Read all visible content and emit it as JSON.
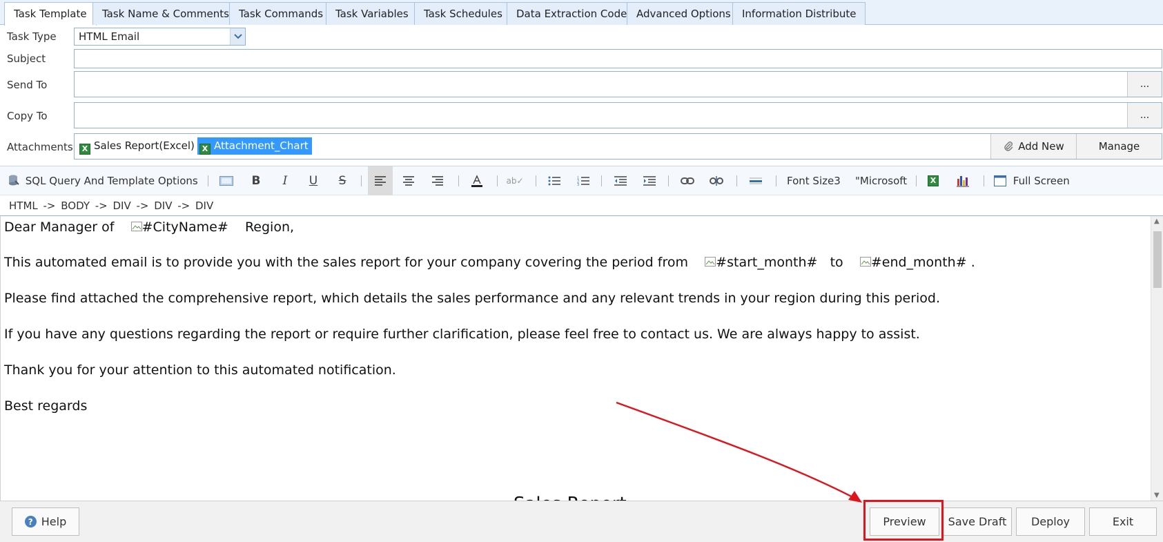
{
  "tabs": [
    {
      "label": "Task Template",
      "active": true
    },
    {
      "label": "Task Name & Comments"
    },
    {
      "label": "Task Commands"
    },
    {
      "label": "Task Variables"
    },
    {
      "label": "Task Schedules"
    },
    {
      "label": "Data Extraction Code"
    },
    {
      "label": "Advanced Options"
    },
    {
      "label": "Information Distribute"
    }
  ],
  "form": {
    "task_type_label": "Task Type",
    "task_type_value": "HTML Email",
    "subject_label": "Subject",
    "subject_value": "",
    "send_to_label": "Send To",
    "send_to_value": "",
    "copy_to_label": "Copy To",
    "copy_to_value": "",
    "browse_label": "...",
    "attachments_label": "Attachments",
    "attachments": [
      {
        "name": "Sales Report(Excel)",
        "selected": false
      },
      {
        "name": "Attachment_Chart",
        "selected": true
      }
    ],
    "add_new_label": "Add New",
    "manage_label": "Manage"
  },
  "toolbar": {
    "sql_options_label": "SQL Query And Template Options",
    "bold": "B",
    "italic": "I",
    "underline": "U",
    "strike": "S",
    "font_size_label": "Font Size3",
    "font_name_label": "\"Microsoft",
    "full_screen_label": "Full Screen"
  },
  "element_path": "HTML -> BODY -> DIV -> DIV -> DIV",
  "editor": {
    "line1_before": "Dear Manager of",
    "placeholder_city": "#CityName#",
    "line1_after": "Region,",
    "line2_before": "This automated email is to provide you with the sales report for your company covering the period from",
    "placeholder_start": "#start_month#",
    "line2_to": "to",
    "placeholder_end": "#end_month#",
    "line2_end": ".",
    "line3": "Please find attached the comprehensive report, which details the sales performance and any relevant trends in your region during this period.",
    "line4": "If you have any questions regarding the report or require further clarification, please feel free to contact us. We are always happy to assist.",
    "line5": "Thank you for your attention to this automated notification.",
    "line6": "Best regards",
    "partial_heading": "Sales Report"
  },
  "buttons": {
    "help": "Help",
    "preview": "Preview",
    "save_draft": "Save Draft",
    "deploy": "Deploy",
    "exit": "Exit"
  },
  "colors": {
    "highlight": "#e0141c",
    "selection": "#3399ff",
    "tab_bg": "#e3eefa"
  }
}
